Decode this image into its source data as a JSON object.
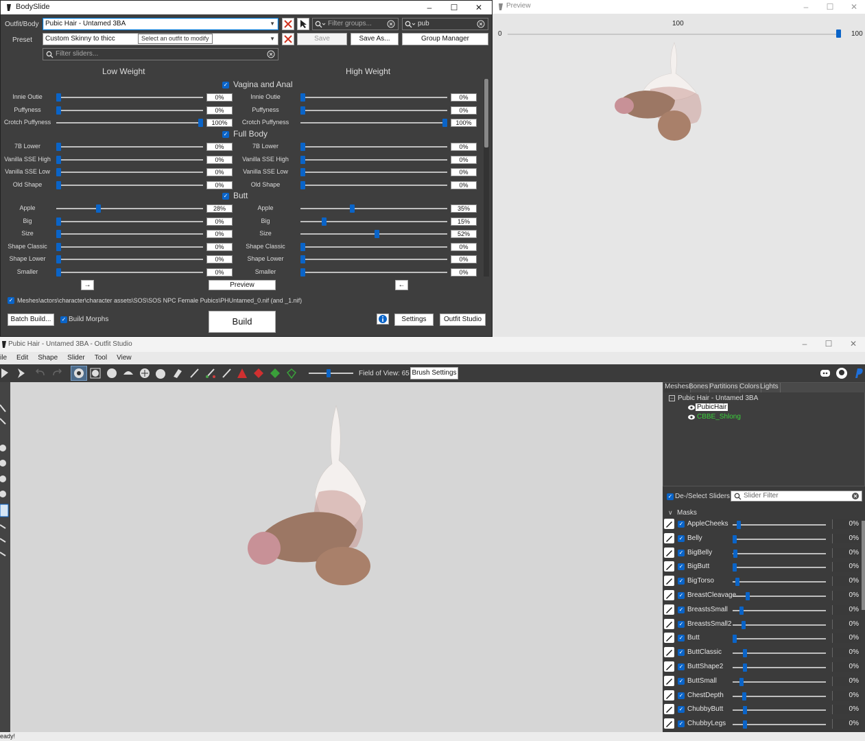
{
  "bodyslide": {
    "title": "BodySlide",
    "outfit_label": "Outfit/Body",
    "outfit_value": "Pubic Hair - Untamed 3BA",
    "filter_groups_placeholder": "Filter groups...",
    "filter_search_value": "pub",
    "preset_label": "Preset",
    "preset_value": "Custom Skinny to thicc",
    "tooltip": "Select an outfit to modify",
    "save_label": "Save",
    "save_as_label": "Save As...",
    "group_manager_label": "Group Manager",
    "filter_sliders_placeholder": "Filter sliders...",
    "low_weight": "Low Weight",
    "high_weight": "High Weight",
    "sections": [
      {
        "title": "Vagina and Anal",
        "sliders": [
          {
            "name": "Innie Outie",
            "low": "0%",
            "high": "0%",
            "low_pos": 0,
            "high_pos": 0
          },
          {
            "name": "Puffyness",
            "low": "0%",
            "high": "0%",
            "low_pos": 0,
            "high_pos": 0
          },
          {
            "name": "Crotch Puffyness",
            "low": "100%",
            "high": "100%",
            "low_pos": 1,
            "high_pos": 1
          }
        ]
      },
      {
        "title": "Full Body",
        "sliders": [
          {
            "name": "7B Lower",
            "low": "0%",
            "high": "0%",
            "low_pos": 0,
            "high_pos": 0
          },
          {
            "name": "Vanilla SSE High",
            "low": "0%",
            "high": "0%",
            "low_pos": 0,
            "high_pos": 0
          },
          {
            "name": "Vanilla SSE Low",
            "low": "0%",
            "high": "0%",
            "low_pos": 0,
            "high_pos": 0
          },
          {
            "name": "Old Shape",
            "low": "0%",
            "high": "0%",
            "low_pos": 0,
            "high_pos": 0
          }
        ]
      },
      {
        "title": "Butt",
        "sliders": [
          {
            "name": "Apple",
            "low": "28%",
            "high": "35%",
            "low_pos": 0.28,
            "high_pos": 0.35
          },
          {
            "name": "Big",
            "low": "0%",
            "high": "15%",
            "low_pos": 0,
            "high_pos": 0.15
          },
          {
            "name": "Size",
            "low": "0%",
            "high": "52%",
            "low_pos": 0,
            "high_pos": 0.52
          },
          {
            "name": "Shape Classic",
            "low": "0%",
            "high": "0%",
            "low_pos": 0,
            "high_pos": 0
          },
          {
            "name": "Shape Lower",
            "low": "0%",
            "high": "0%",
            "low_pos": 0,
            "high_pos": 0
          },
          {
            "name": "Smaller",
            "low": "0%",
            "high": "0%",
            "low_pos": 0,
            "high_pos": 0
          }
        ]
      }
    ],
    "arrow_right": "→",
    "arrow_left": "←",
    "preview_label": "Preview",
    "output_path": "Meshes\\actors\\character\\character assets\\SOS\\SOS NPC Female Pubics\\PHUntamed_0.nif (and _1.nif)",
    "batch_build_label": "Batch Build...",
    "build_morphs_label": "Build Morphs",
    "build_label": "Build",
    "settings_label": "Settings",
    "outfit_studio_label": "Outfit Studio"
  },
  "preview": {
    "title": "Preview",
    "weight_value": "100",
    "weight_min": "0",
    "weight_max": "100",
    "weight_pos": 1
  },
  "studio": {
    "title": "Pubic Hair - Untamed 3BA - Outfit Studio",
    "menu": [
      "ile",
      "Edit",
      "Shape",
      "Slider",
      "Tool",
      "View"
    ],
    "fov_label": "Field of View: 65",
    "brush_settings_label": "Brush Settings",
    "tabs": [
      "Meshes",
      "Bones",
      "Partitions",
      "Colors",
      "Lights"
    ],
    "tree_root": "Pubic Hair - Untamed 3BA",
    "mesh_selected": "PubicHair",
    "mesh_other": "CBBE_Shlong",
    "mesh_other_color": "#3ad23a",
    "deselect_label": "De-/Select Sliders",
    "slider_filter_placeholder": "Slider Filter",
    "masks_label": "Masks",
    "sliders": [
      {
        "name": "AppleCheeks",
        "value": "0%"
      },
      {
        "name": "Belly",
        "value": "0%"
      },
      {
        "name": "BigBelly",
        "value": "0%"
      },
      {
        "name": "BigButt",
        "value": "0%"
      },
      {
        "name": "BigTorso",
        "value": "0%"
      },
      {
        "name": "BreastCleavage",
        "value": "0%"
      },
      {
        "name": "BreastsSmall",
        "value": "0%"
      },
      {
        "name": "BreastsSmall2",
        "value": "0%"
      },
      {
        "name": "Butt",
        "value": "0%"
      },
      {
        "name": "ButtClassic",
        "value": "0%"
      },
      {
        "name": "ButtShape2",
        "value": "0%"
      },
      {
        "name": "ButtSmall",
        "value": "0%"
      },
      {
        "name": "ChestDepth",
        "value": "0%"
      },
      {
        "name": "ChubbyButt",
        "value": "0%"
      },
      {
        "name": "ChubbyLegs",
        "value": "0%"
      }
    ],
    "status": "eady!",
    "accent": "#0a64c8"
  }
}
